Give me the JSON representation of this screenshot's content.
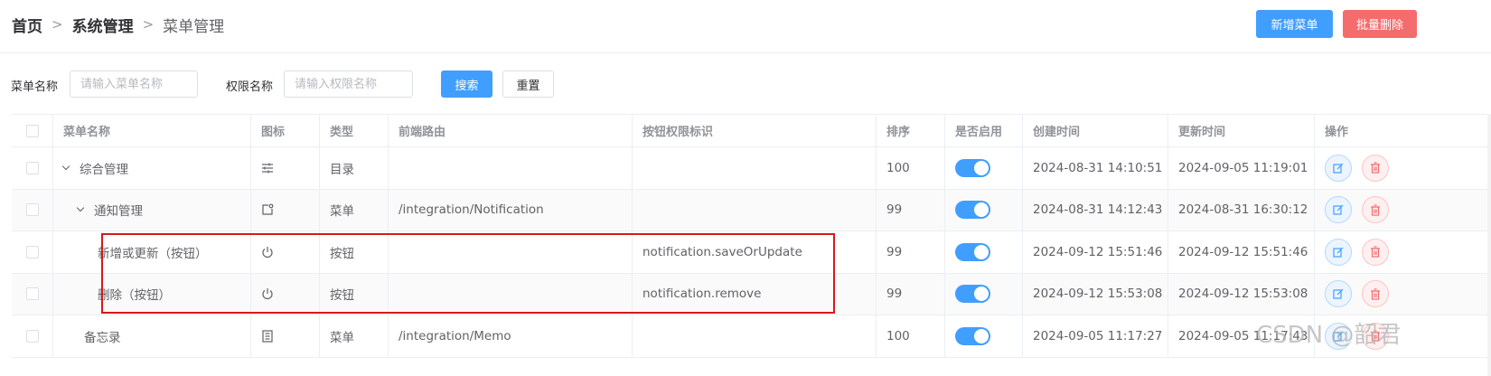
{
  "breadcrumb": [
    "首页",
    "系统管理",
    "菜单管理"
  ],
  "toolbar": {
    "add_label": "新增菜单",
    "batch_delete_label": "批量删除"
  },
  "search": {
    "menu_name_label": "菜单名称",
    "menu_name_placeholder": "请输入菜单名称",
    "perm_name_label": "权限名称",
    "perm_name_placeholder": "请输入权限名称",
    "search_label": "搜索",
    "reset_label": "重置"
  },
  "table": {
    "columns": [
      "菜单名称",
      "图标",
      "类型",
      "前端路由",
      "按钮权限标识",
      "排序",
      "是否启用",
      "创建时间",
      "更新时间",
      "操作"
    ],
    "rows": [
      {
        "name": "综合管理",
        "icon": "sliders-icon",
        "type": "目录",
        "route": "",
        "perm": "",
        "order": "100",
        "enabled": true,
        "created": "2024-08-31 14:10:51",
        "updated": "2024-09-05 11:19:01"
      },
      {
        "name": "通知管理",
        "icon": "notification-icon",
        "type": "菜单",
        "route": "/integration/Notification",
        "perm": "",
        "order": "99",
        "enabled": true,
        "created": "2024-08-31 14:12:43",
        "updated": "2024-08-31 16:30:12"
      },
      {
        "name": "新增或更新（按钮）",
        "icon": "power-icon",
        "type": "按钮",
        "route": "",
        "perm": "notification.saveOrUpdate",
        "order": "99",
        "enabled": true,
        "created": "2024-09-12 15:51:46",
        "updated": "2024-09-12 15:51:46"
      },
      {
        "name": "删除（按钮）",
        "icon": "power-icon",
        "type": "按钮",
        "route": "",
        "perm": "notification.remove",
        "order": "99",
        "enabled": true,
        "created": "2024-09-12 15:53:08",
        "updated": "2024-09-12 15:53:08"
      },
      {
        "name": "备忘录",
        "icon": "document-icon",
        "type": "菜单",
        "route": "/integration/Memo",
        "perm": "",
        "order": "100",
        "enabled": true,
        "created": "2024-09-05 11:17:27",
        "updated": "2024-09-05 11:17:43"
      }
    ]
  },
  "watermark": "CSDN @韶君",
  "colors": {
    "primary": "#409eff",
    "danger": "#f56c6c",
    "highlight": "#d7191c"
  }
}
